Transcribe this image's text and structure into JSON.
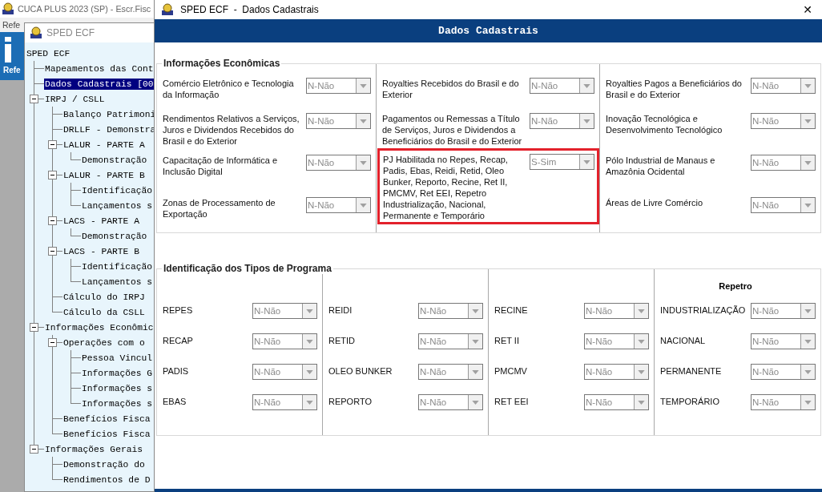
{
  "app_window": {
    "title": "CUCA PLUS 2023 (SP) - Escr.Fisc",
    "menu": [
      "Refe"
    ],
    "ribbon_label": "Refe"
  },
  "tree_window": {
    "title": "SPED ECF",
    "tree": [
      {
        "label": "SPED ECF",
        "selected": false,
        "children": [
          {
            "label": "Mapeamentos das Cont",
            "selected": false
          },
          {
            "label": "Dados Cadastrais [00",
            "selected": true
          },
          {
            "label": "IRPJ / CSLL",
            "selected": false,
            "expanded": true,
            "children": [
              {
                "label": "Balanço Patrimoni",
                "selected": false
              },
              {
                "label": "DRLLF - Demonstra",
                "selected": false
              },
              {
                "label": "LALUR - PARTE A",
                "selected": false,
                "expanded": true,
                "children": [
                  {
                    "label": "Demonstração",
                    "selected": false
                  }
                ]
              },
              {
                "label": "LALUR - PARTE B",
                "selected": false,
                "expanded": true,
                "children": [
                  {
                    "label": "Identificação",
                    "selected": false
                  },
                  {
                    "label": "Lançamentos s",
                    "selected": false
                  }
                ]
              },
              {
                "label": "LACS - PARTE A",
                "selected": false,
                "expanded": true,
                "children": [
                  {
                    "label": "Demonstração",
                    "selected": false
                  }
                ]
              },
              {
                "label": "LACS - PARTE B",
                "selected": false,
                "expanded": true,
                "children": [
                  {
                    "label": "Identificação",
                    "selected": false
                  },
                  {
                    "label": "Lançamentos s",
                    "selected": false
                  }
                ]
              },
              {
                "label": "Cálculo do IRPJ",
                "selected": false
              },
              {
                "label": "Cálculo da CSLL",
                "selected": false
              }
            ]
          },
          {
            "label": "Informações Econômic",
            "selected": false,
            "expanded": true,
            "children": [
              {
                "label": "Operações com o",
                "selected": false,
                "expanded": true,
                "children": [
                  {
                    "label": "Pessoa Vincul",
                    "selected": false
                  },
                  {
                    "label": "Informações G",
                    "selected": false
                  },
                  {
                    "label": "Informações s",
                    "selected": false
                  },
                  {
                    "label": "Informações s",
                    "selected": false
                  }
                ]
              },
              {
                "label": "Benefícios Fisca",
                "selected": false
              },
              {
                "label": "Benefícios Fisca",
                "selected": false
              }
            ]
          },
          {
            "label": "Informações Gerais",
            "selected": false,
            "expanded": true,
            "children": [
              {
                "label": "Demonstração do",
                "selected": false
              },
              {
                "label": "Rendimentos de D",
                "selected": false
              }
            ]
          }
        ]
      }
    ]
  },
  "dialog": {
    "title": "SPED ECF  -  Dados Cadastrais",
    "close": "✕",
    "header": "Dados Cadastrais",
    "economic": {
      "legend": "Informações Econômicas",
      "columns": [
        {
          "rows": [
            {
              "label": "Comércio Eletrônico e Tecnologia da Informação",
              "value": "N-Não",
              "disabled": true,
              "highlighted": false
            },
            {
              "label": "Rendimentos Relativos a Serviços, Juros e Dividendos Recebidos do Brasil e do Exterior",
              "value": "N-Não",
              "disabled": true,
              "highlighted": false
            },
            {
              "label": "Capacitação de Informática e Inclusão Digital",
              "value": "N-Não",
              "disabled": true,
              "highlighted": false
            },
            {
              "label": "Zonas de Processamento de Exportação",
              "value": "N-Não",
              "disabled": true,
              "highlighted": false
            }
          ]
        },
        {
          "rows": [
            {
              "label": "Royalties Recebidos do Brasil e do Exterior",
              "value": "N-Não",
              "disabled": true,
              "highlighted": false
            },
            {
              "label": "Pagamentos ou Remessas a Título de Serviços, Juros e Dividendos a Beneficiários do Brasil e do Exterior",
              "value": "N-Não",
              "disabled": true,
              "highlighted": false
            },
            {
              "label": "PJ Habilitada no Repes, Recap, Padis, Ebas, Reidi, Retid, Oleo Bunker, Reporto, Recine, Ret II, PMCMV, Ret EEI, Repetro Industrialização, Nacional, Permanente e Temporário",
              "value": "S-Sim",
              "disabled": true,
              "highlighted": true
            }
          ]
        },
        {
          "rows": [
            {
              "label": "Royalties Pagos a Beneficiários do Brasil e do Exterior",
              "value": "N-Não",
              "disabled": true,
              "highlighted": false
            },
            {
              "label": "Inovação Tecnológica e Desenvolvimento Tecnológico",
              "value": "N-Não",
              "disabled": true,
              "highlighted": false
            },
            {
              "label": "Pólo Industrial de Manaus e Amazônia Ocidental",
              "value": "N-Não",
              "disabled": true,
              "highlighted": false
            },
            {
              "label": "Áreas de Livre Comércio",
              "value": "N-Não",
              "disabled": true,
              "highlighted": false
            }
          ]
        }
      ]
    },
    "programs": {
      "legend": "Identificação dos Tipos de Programa",
      "columns": [
        {
          "rows": [
            {
              "label": "REPES",
              "value": "N-Não",
              "disabled": true
            },
            {
              "label": "RECAP",
              "value": "N-Não",
              "disabled": true
            },
            {
              "label": "PADIS",
              "value": "N-Não",
              "disabled": true
            },
            {
              "label": "EBAS",
              "value": "N-Não",
              "disabled": true
            }
          ]
        },
        {
          "rows": [
            {
              "label": "REIDI",
              "value": "N-Não",
              "disabled": true
            },
            {
              "label": "RETID",
              "value": "N-Não",
              "disabled": true
            },
            {
              "label": "OLEO BUNKER",
              "value": "N-Não",
              "disabled": true
            },
            {
              "label": "REPORTO",
              "value": "N-Não",
              "disabled": true
            }
          ]
        },
        {
          "rows": [
            {
              "label": "RECINE",
              "value": "N-Não",
              "disabled": true
            },
            {
              "label": "RET II",
              "value": "N-Não",
              "disabled": true
            },
            {
              "label": "PMCMV",
              "value": "N-Não",
              "disabled": true
            },
            {
              "label": "RET EEI",
              "value": "N-Não",
              "disabled": true
            }
          ]
        },
        {
          "heading": "Repetro",
          "rows": [
            {
              "label": "INDUSTRIALIZAÇÃO",
              "value": "N-Não",
              "disabled": true
            },
            {
              "label": "NACIONAL",
              "value": "N-Não",
              "disabled": true
            },
            {
              "label": "PERMANENTE",
              "value": "N-Não",
              "disabled": true
            },
            {
              "label": "TEMPORÁRIO",
              "value": "N-Não",
              "disabled": true
            }
          ]
        }
      ]
    }
  }
}
